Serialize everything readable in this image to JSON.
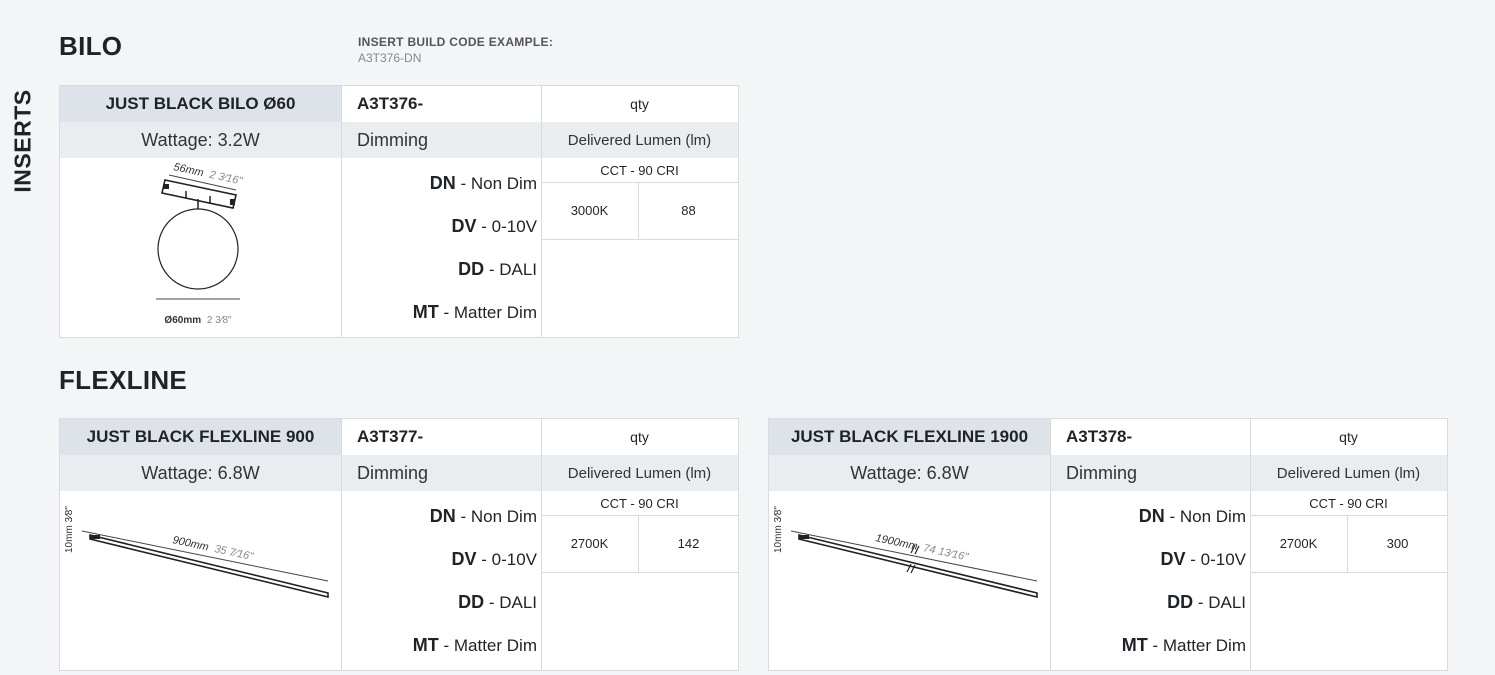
{
  "side_label": "INSERTS",
  "bilo": {
    "title": "BILO",
    "build_code_label": "INSERT BUILD CODE EXAMPLE:",
    "build_code_value": "A3T376-DN",
    "spec": {
      "name": "JUST BLACK BILO Ø60",
      "code": "A3T376-",
      "qty": "qty",
      "wattage": "Wattage: 3.2W",
      "dimming_header": "Dimming",
      "lumen_header": "Delivered Lumen (lm)",
      "cct_header": "CCT - 90 CRI",
      "cct": "3000K",
      "lumen": "88",
      "drawing_dim_top": "56mm",
      "drawing_dim_top_in": "2 3⁄16\"",
      "drawing_dim_bottom": "Ø60mm",
      "drawing_dim_bottom_in": "2 3⁄8\""
    }
  },
  "flexline": {
    "title": "FLEXLINE",
    "spec900": {
      "name": "JUST BLACK FLEXLINE 900",
      "code": "A3T377-",
      "qty": "qty",
      "wattage": "Wattage: 6.8W",
      "dimming_header": "Dimming",
      "lumen_header": "Delivered Lumen (lm)",
      "cct_header": "CCT - 90 CRI",
      "cct": "2700K",
      "lumen": "142",
      "drawing_len": "900mm",
      "drawing_len_in": "35 7⁄16\"",
      "drawing_height": "10mm 3⁄8\""
    },
    "spec1900": {
      "name": "JUST BLACK FLEXLINE 1900",
      "code": "A3T378-",
      "qty": "qty",
      "wattage": "Wattage: 6.8W",
      "dimming_header": "Dimming",
      "lumen_header": "Delivered Lumen (lm)",
      "cct_header": "CCT - 90 CRI",
      "cct": "2700K",
      "lumen": "300",
      "drawing_len": "1900mm",
      "drawing_len_in": "74 13⁄16\"",
      "drawing_height": "10mm 3⁄8\""
    }
  },
  "dimming_options": [
    {
      "code": "DN",
      "label": " - Non Dim"
    },
    {
      "code": "DV",
      "label": " - 0-10V"
    },
    {
      "code": "DD",
      "label": " - DALI"
    },
    {
      "code": "MT",
      "label": " - Matter Dim"
    }
  ],
  "colors": {
    "page_bg": "#f3f5f7",
    "header_bg": "#dde3e8",
    "subheader_bg": "#eaedf0",
    "border": "#d7dce1"
  }
}
